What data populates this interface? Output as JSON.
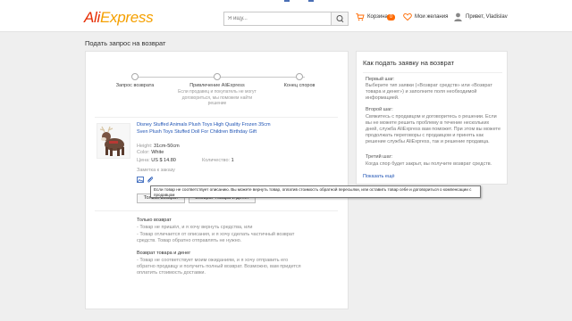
{
  "header": {
    "logo_a": "Ali",
    "logo_b": "Express",
    "search_placeholder": "Я ищу...",
    "cart_label": "Корзина",
    "cart_count": "0",
    "wishlist_label": "Мои желания",
    "greeting": "Привет, Vladislav"
  },
  "page_title": "Подать запрос на возврат",
  "steps": [
    {
      "label": "Запрос возврата"
    },
    {
      "label": "Привлечение AliExpress",
      "note": "Если продавец и покупатель не могут договориться, мы поможем найти решение"
    },
    {
      "label": "Конец споров"
    }
  ],
  "product": {
    "title": "Disney Stuffed Animals Plush Toys High Quality Frozen 35cm Sven Plush Toys Stuffed Doll For Children Birthday Gift",
    "height_label": "Height:",
    "height_value": "31cm-50cm",
    "color_label": "Color:",
    "color_value": "White",
    "price_label": "Цена:",
    "price_value": "US $ 14.80",
    "qty_label": "Количество:",
    "qty_value": "1",
    "order_note": "Заметка к заказу"
  },
  "tooltip": "Если товар не соответствует описанию. Вы можете вернуть товар, оплатив стоимость обратной пересылки, или оставить товар себе и договориться о компенсации с продавцом",
  "buttons": {
    "return_only": "Только возврат",
    "return_goods_money": "Возврат товара и денег"
  },
  "info": {
    "sec1_title": "Только возврат",
    "sec1_lines": [
      "- Товар не пришёл, и я хочу вернуть средства, или",
      "- Товар отличается от описания, и я хочу сделать частичный возврат средств. Товар обратно отправлять не нужно."
    ],
    "sec2_title": "Возврат товара и денег",
    "sec2_lines": [
      "- Товар не соответствует моим ожиданиям, и я хочу отправить его обратно продавцу и получить полный возврат. Возможно, вам придется оплатить стоимость доставки."
    ]
  },
  "sidebar": {
    "title": "Как подать заявку на возврат",
    "step1_label": "Первый шаг:",
    "step1_text": "Выберите тип заявки («Возврат средств» или «Возврат товара и денег») и заполните поля необходимой информацией.",
    "step2_label": "Второй шаг:",
    "step2_text": "Свяжитесь с продавцом и договоритесь о решении. Если вы не можете решить проблему в течение нескольких дней, служба AliExpress вам поможет. При этом вы можете продолжать переговоры с продавцом и принять как решение службы AliExpress, так и решение продавца.",
    "step3_label": "Третий шаг:",
    "step3_text": "Когда спор будет закрыт, вы получите возврат средств.",
    "more_link": "Показать ещё"
  },
  "colors": {
    "brand_red": "#e62e04",
    "brand_orange": "#f5a000",
    "link_blue": "#2155b5",
    "badge": "#ff6a00"
  },
  "icons": [
    "search-icon",
    "cart-icon",
    "heart-icon",
    "user-icon",
    "image-icon",
    "attachment-icon"
  ]
}
